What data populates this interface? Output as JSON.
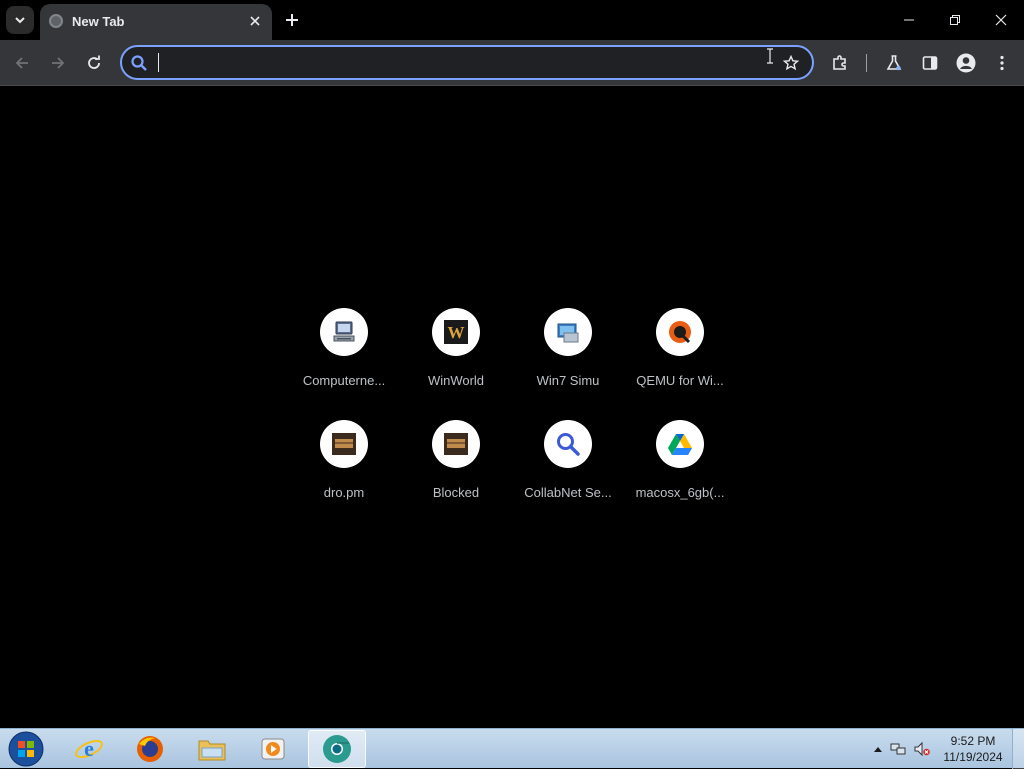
{
  "tab": {
    "title": "New Tab"
  },
  "omnibox": {
    "value": "",
    "placeholder": ""
  },
  "shortcuts": [
    {
      "label": "Computerne...",
      "icon": "computer-icon"
    },
    {
      "label": "WinWorld",
      "icon": "winworld-icon"
    },
    {
      "label": "Win7 Simu",
      "icon": "win7-simu-icon"
    },
    {
      "label": "QEMU for Wi...",
      "icon": "qemu-icon"
    },
    {
      "label": "dro.pm",
      "icon": "dro-pm-icon"
    },
    {
      "label": "Blocked",
      "icon": "blocked-site-icon"
    },
    {
      "label": "CollabNet Se...",
      "icon": "search-icon"
    },
    {
      "label": "macosx_6gb(...",
      "icon": "google-drive-icon"
    }
  ],
  "taskbar": {
    "apps": [
      "internet-explorer-icon",
      "firefox-icon",
      "file-explorer-icon",
      "media-player-icon",
      "chrome-icon"
    ]
  },
  "clock": {
    "time": "9:52 PM",
    "date": "11/19/2024"
  },
  "colors": {
    "omnibox_focus": "#7ca1ff",
    "toolbar": "#35363a",
    "page_bg": "#000000"
  }
}
